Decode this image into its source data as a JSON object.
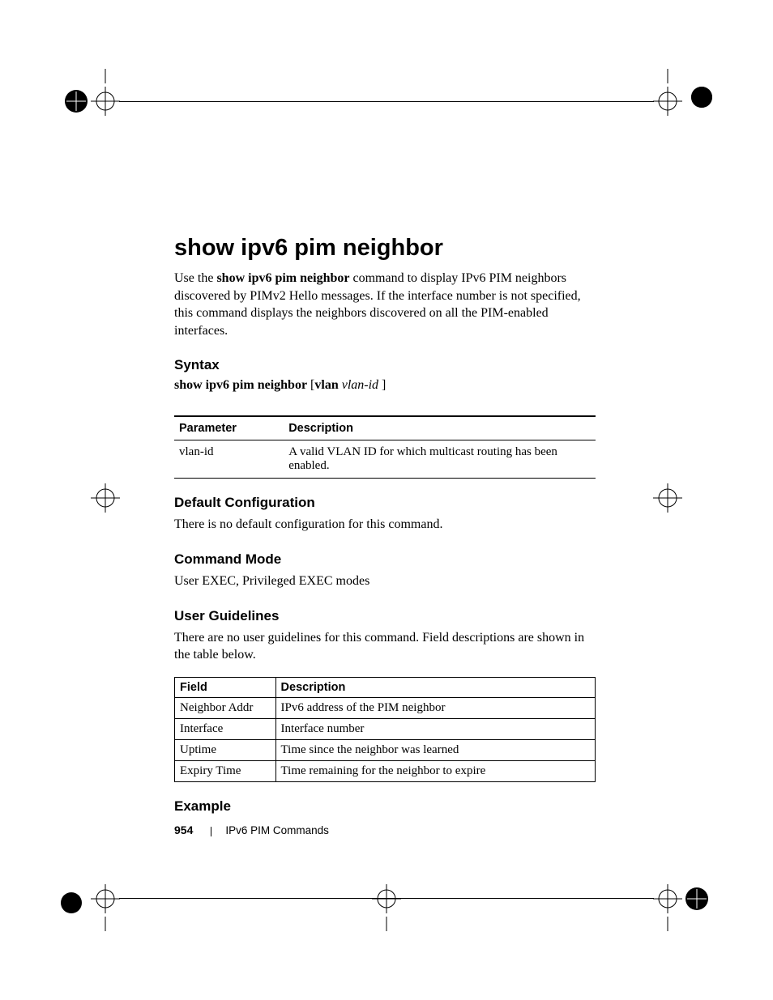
{
  "title": "show ipv6 pim neighbor",
  "intro_pre": "Use the ",
  "intro_bold": "show ipv6 pim neighbor",
  "intro_post": " command to display IPv6 PIM neighbors discovered by PIMv2 Hello messages. If the interface number is not specified, this command displays the neighbors discovered on all the PIM-enabled interfaces.",
  "sections": {
    "syntax": "Syntax",
    "default_config": "Default Configuration",
    "command_mode": "Command Mode",
    "user_guidelines": "User Guidelines",
    "example": "Example"
  },
  "syntax_line": {
    "cmd": "show ipv6 pim neighbor",
    "lbr": " [",
    "kw": "vlan",
    "sp": " ",
    "arg": "vlan-id",
    "rbr": " ]"
  },
  "param_table": {
    "headers": {
      "param": "Parameter",
      "desc": "Description"
    },
    "rows": [
      {
        "param": "vlan-id",
        "desc": "A valid VLAN ID for which multicast routing has been enabled."
      }
    ]
  },
  "default_config_text": "There is no default configuration for this command.",
  "command_mode_text": "User EXEC, Privileged EXEC modes",
  "user_guidelines_text": "There are no user guidelines for this command. Field descriptions are shown in the table below.",
  "fields_table": {
    "headers": {
      "field": "Field",
      "desc": "Description"
    },
    "rows": [
      {
        "field": "Neighbor Addr",
        "desc": "IPv6 address of the PIM neighbor"
      },
      {
        "field": "Interface",
        "desc": "Interface number"
      },
      {
        "field": "Uptime",
        "desc": "Time since the neighbor was learned"
      },
      {
        "field": "Expiry Time",
        "desc": "Time remaining for the neighbor to expire"
      }
    ]
  },
  "footer": {
    "page": "954",
    "chapter": "IPv6 PIM Commands"
  }
}
